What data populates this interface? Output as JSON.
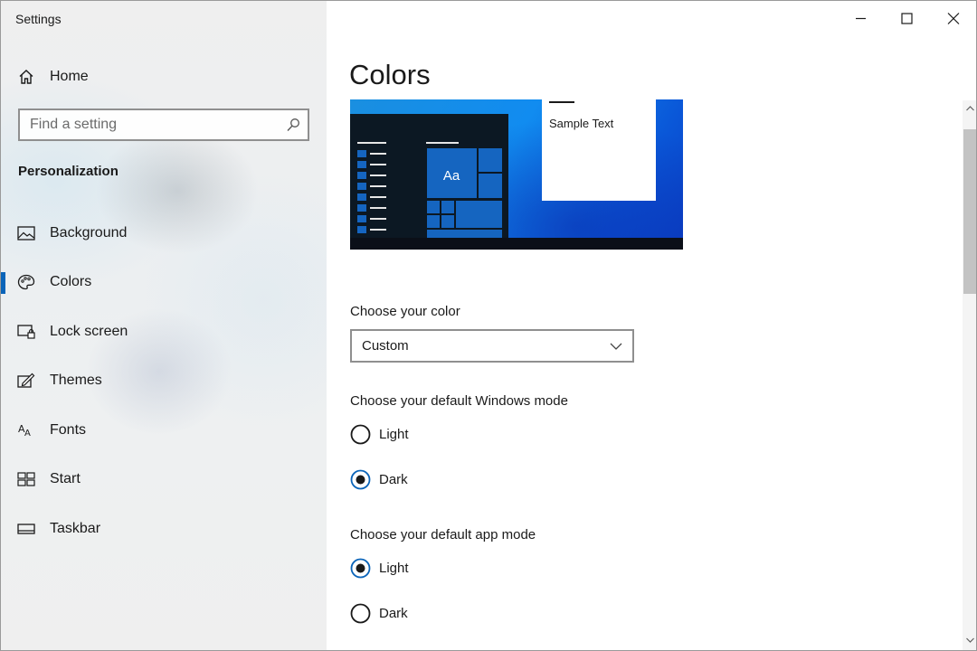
{
  "window": {
    "title": "Settings",
    "controls": [
      "minimize-icon",
      "maximize-icon",
      "close-icon"
    ]
  },
  "sidebar": {
    "home": {
      "label": "Home",
      "icon": "home-icon"
    },
    "search": {
      "placeholder": "Find a setting",
      "value": "",
      "icon": "search-icon"
    },
    "section_title": "Personalization",
    "items": [
      {
        "label": "Background",
        "icon": "picture-icon",
        "active": false
      },
      {
        "label": "Colors",
        "icon": "palette-icon",
        "active": true
      },
      {
        "label": "Lock screen",
        "icon": "lock-screen-icon",
        "active": false
      },
      {
        "label": "Themes",
        "icon": "themes-icon",
        "active": false
      },
      {
        "label": "Fonts",
        "icon": "fonts-icon",
        "active": false
      },
      {
        "label": "Start",
        "icon": "start-icon",
        "active": false
      },
      {
        "label": "Taskbar",
        "icon": "taskbar-icon",
        "active": false
      }
    ]
  },
  "main": {
    "title": "Colors",
    "preview": {
      "sample_text": "Sample Text",
      "tile_text": "Aa"
    },
    "choose_color": {
      "label": "Choose your color",
      "selected": "Custom"
    },
    "windows_mode": {
      "label": "Choose your default Windows mode",
      "options": [
        {
          "label": "Light",
          "checked": false
        },
        {
          "label": "Dark",
          "checked": true
        }
      ]
    },
    "app_mode": {
      "label": "Choose your default app mode",
      "options": [
        {
          "label": "Light",
          "checked": true
        },
        {
          "label": "Dark",
          "checked": false
        }
      ]
    }
  },
  "colors": {
    "accent": "#0a64b9",
    "start_bg": "#0c1823",
    "tile": "#1565c0",
    "wallpaper": "#118cf0"
  }
}
